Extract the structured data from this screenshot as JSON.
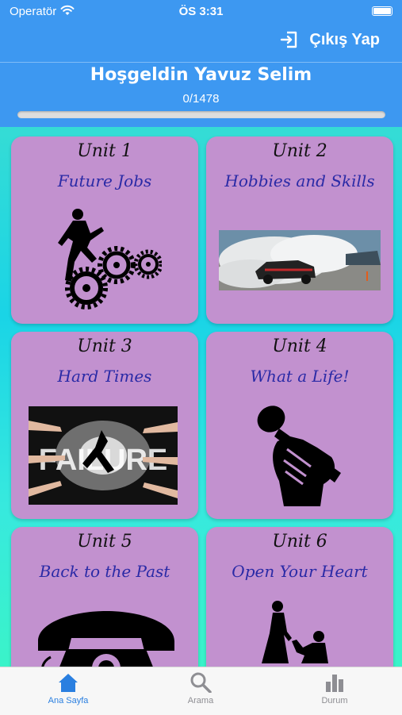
{
  "status_bar": {
    "carrier": "Operatör",
    "time": "ÖS 3:31"
  },
  "header": {
    "logout_label": "Çıkış Yap",
    "welcome": "Hoşgeldin Yavuz Selim",
    "progress_text": "0/1478",
    "progress_fraction": 0.0
  },
  "units": [
    {
      "label": "Unit 1",
      "title": "Future Jobs",
      "icon": "gears-climber-icon"
    },
    {
      "label": "Unit 2",
      "title": "Hobbies and Skills",
      "icon": "drifting-car-photo"
    },
    {
      "label": "Unit 3",
      "title": "Hard Times",
      "icon": "failure-photo"
    },
    {
      "label": "Unit 4",
      "title": "What a Life!",
      "icon": "microphone-fist-icon"
    },
    {
      "label": "Unit 5",
      "title": "Back to the Past",
      "icon": "telephone-icon"
    },
    {
      "label": "Unit 6",
      "title": "Open Your Heart",
      "icon": "proposal-icon"
    }
  ],
  "tabs": [
    {
      "label": "Ana Sayfa",
      "icon": "home-icon",
      "active": true
    },
    {
      "label": "Arama",
      "icon": "search-icon",
      "active": false
    },
    {
      "label": "Durum",
      "icon": "bar-chart-icon",
      "active": false
    }
  ],
  "colors": {
    "header": "#3d98f1",
    "card": "#c291cf",
    "title": "#2a2aa6",
    "active_tab": "#2a7fe0"
  }
}
